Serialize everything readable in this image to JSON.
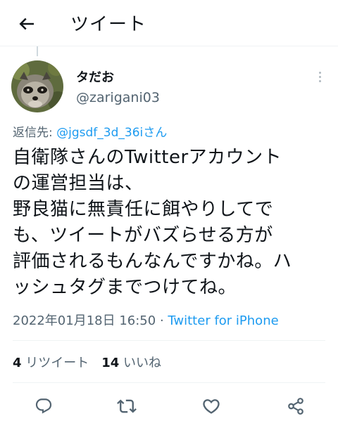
{
  "header": {
    "title": "ツイート",
    "back_icon": "arrow-left-icon"
  },
  "author": {
    "name": "タだお",
    "handle": "@zarigani03",
    "avatar": "raccoon-dog-photo"
  },
  "reply": {
    "prefix": "返信先: ",
    "target": "@jgsdf_3d_36iさん"
  },
  "tweet": {
    "lines": [
      "自衛隊さんのTwitterアカウント",
      "の運営担当は、",
      "野良猫に無責任に餌やりしてで",
      "も、ツイートがバズらせる方が",
      "評価されるもんなんですかね。ハ",
      "ッシュタグまでつけてね。"
    ]
  },
  "meta": {
    "timestamp": "2022年01月18日 16:50",
    "separator": " · ",
    "source": "Twitter for iPhone"
  },
  "stats": {
    "retweets_count": "4",
    "retweets_label": " リツイート",
    "likes_count": "14",
    "likes_label": " いいね"
  },
  "actions": {
    "reply_icon": "reply-icon",
    "retweet_icon": "retweet-icon",
    "like_icon": "like-icon",
    "share_icon": "share-icon"
  },
  "colors": {
    "link": "#1d9bf0",
    "secondary_text": "#536471",
    "primary_text": "#0f1419"
  }
}
